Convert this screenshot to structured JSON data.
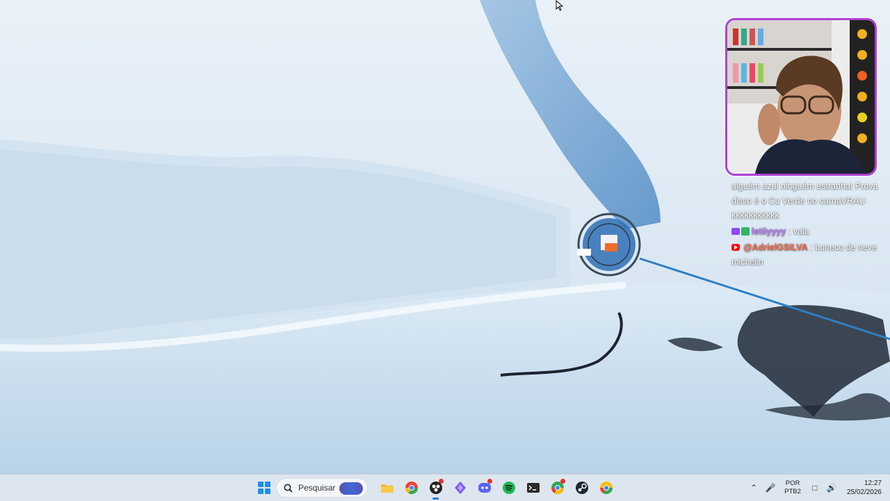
{
  "chat": {
    "messages": [
      {
        "platform": "twitch",
        "user": "",
        "text": "alguém azul ninguém estranha! Prova disso é o Cu Verde no carnaVRAU kkkkkkkkkkk"
      },
      {
        "platform": "twitch",
        "user": "letiiyyyy",
        "separator": " : ",
        "text": "vala"
      },
      {
        "platform": "youtube",
        "user": "@AdrielGSILVA",
        "separator": " : ",
        "text": "boneco de neve michelin"
      }
    ]
  },
  "taskbar": {
    "search_placeholder": "Pesquisar",
    "apps": [
      {
        "name": "File Explorer",
        "icon": "folder-icon",
        "color": "#f2b632"
      },
      {
        "name": "Google Chrome",
        "icon": "chrome-icon",
        "color": "#e94235"
      },
      {
        "name": "OBS Studio",
        "icon": "obs-icon",
        "color": "#222222"
      },
      {
        "name": "App",
        "icon": "diamond-app-icon",
        "color": "#7a5cf0"
      },
      {
        "name": "Discord",
        "icon": "discord-icon",
        "color": "#5865f2"
      },
      {
        "name": "Spotify",
        "icon": "spotify-icon",
        "color": "#1db954"
      },
      {
        "name": "Terminal",
        "icon": "terminal-icon",
        "color": "#2b2b2b"
      },
      {
        "name": "Chrome Profile",
        "icon": "chrome-profile-icon",
        "color": "#34a853"
      },
      {
        "name": "Steam",
        "icon": "steam-icon",
        "color": "#1b2838"
      },
      {
        "name": "Chrome Profile 2",
        "icon": "chrome-profile-2-icon",
        "color": "#fbbc05"
      }
    ],
    "tray": {
      "language_top": "POR",
      "language_bottom": "PTB2",
      "time": "12:27",
      "date": "25/02/2026"
    }
  },
  "colors": {
    "webcam_border": "#b13fd6",
    "accent": "#2a78d4"
  }
}
